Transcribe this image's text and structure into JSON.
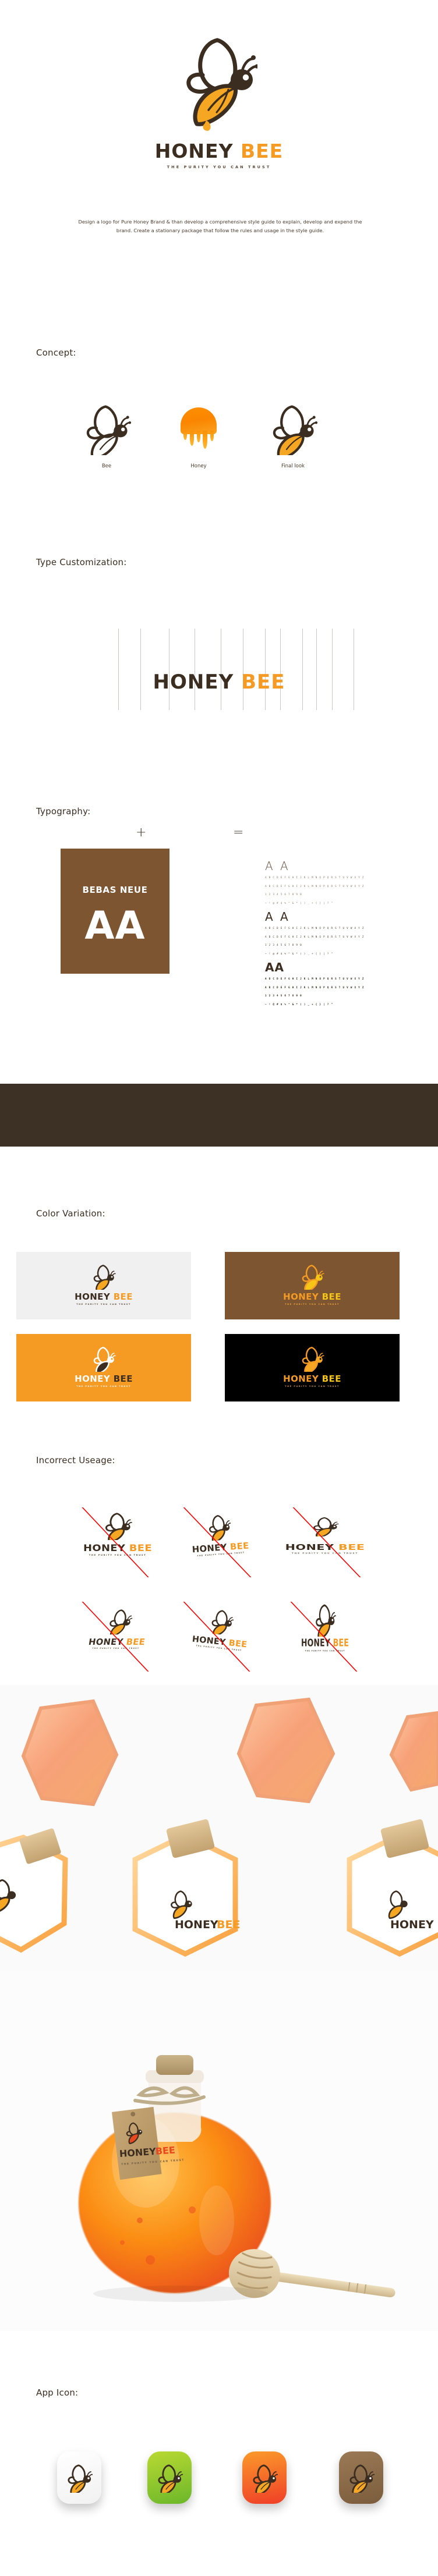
{
  "brand": {
    "name_part1": "HONEY",
    "name_part2": "BEE",
    "tagline": "THE PURITY YOU CAN TRUST",
    "description": "Design a logo for Pure Honey Brand & than develop a comprehensive style guide to explain, develop and expend the brand. Create a stationary package that follow the rules and usage in the style guide.",
    "colors": {
      "brown_dark": "#3b2d20",
      "brown_band": "#3d3025",
      "brown_card": "#7d5530",
      "orange": "#f59a23",
      "orange_deep": "#fb8500",
      "amber": "#f5c518",
      "light_grey": "#f0f0f0",
      "black": "#000000",
      "white": "#ffffff",
      "red_strike": "#ff0000",
      "green": "#8cc63e"
    }
  },
  "sections": {
    "concept": {
      "heading": "Concept:",
      "items": [
        {
          "label": "Bee",
          "icon": "bee-outline-icon"
        },
        {
          "label": "Honey",
          "icon": "honey-drip-icon"
        },
        {
          "label": "Final look",
          "icon": "bee-final-icon"
        }
      ],
      "operators": [
        "+",
        "="
      ]
    },
    "type_customization": {
      "heading": "Type Customization:",
      "word_part1": "HONEY",
      "word_part2": "BEE",
      "guide_line_count": 12
    },
    "typography": {
      "heading": "Typography:",
      "font_name": "BEBAS NEUE",
      "card_sample": "AA",
      "specimens": [
        {
          "weight": "light",
          "sample": "A A",
          "uppercase": "A B C D E F G H I J K L M N O P Q R S T U V W X Y Z",
          "lowercase": "A B C D E F G H I J K L M N O P Q R S T U V W X Y Z",
          "numerals": "1 2 3 4 5 6 7 8 9 0",
          "symbols": "~ ! @ # $ % ^ & * ( ) _ + { } | ? \""
        },
        {
          "weight": "regular",
          "sample": "A A",
          "uppercase": "A B C D E F G H I J K L M N O P Q R S T U V W X Y Z",
          "lowercase": "A B C D E F G H I J K L M N O P Q R S T U V W X Y Z",
          "numerals": "1 2 3 4 5 6 7 8 9 0",
          "symbols": "~ ! @ # $ % ^ & * ( ) _ + { } | ? \""
        },
        {
          "weight": "bold",
          "sample": "AA",
          "uppercase": "A B C D E F G H I J K L M N O P Q R S T U V W X Y Z",
          "lowercase": "A B C D E F G H I J K L M N O P Q R S T U V W X Y Z",
          "numerals": "1 2 3 4 5 6 7 8 9 0",
          "symbols": "~ ! @ # $ % ^ & * ( ) _ + { } | ? \""
        }
      ]
    },
    "color_variation": {
      "heading": "Color Variation:",
      "swatches": [
        {
          "name": "light",
          "bg": "#f0f0f0",
          "word1_color": "#3b2d20",
          "word2_color": "#f59a23",
          "tag_color": "#5a4734",
          "body_color": "#f5a623",
          "outline_color": "#3b2d20"
        },
        {
          "name": "brown",
          "bg": "#7d5530",
          "word1_color": "#f59a23",
          "word2_color": "#f5c518",
          "tag_color": "#f0a93c",
          "body_color": "#f5c518",
          "outline_color": "#f59a23"
        },
        {
          "name": "orange",
          "bg": "#f59a23",
          "word1_color": "#ffffff",
          "word2_color": "#3b2d20",
          "tag_color": "#ffffff",
          "body_color": "#3b2d20",
          "outline_color": "#ffffff"
        },
        {
          "name": "black",
          "bg": "#000000",
          "word1_color": "#f59a23",
          "word2_color": "#f5c518",
          "tag_color": "#d79a3c",
          "body_color": "#f5a623",
          "outline_color": "#f59a23"
        }
      ]
    },
    "incorrect_usage": {
      "heading": "Incorrect Useage:",
      "variants": [
        {
          "name": "stretched-horizontal"
        },
        {
          "name": "arched-warped"
        },
        {
          "name": "condensed-wide"
        },
        {
          "name": "skewed-italic"
        },
        {
          "name": "rotated"
        },
        {
          "name": "squeezed-vertical"
        }
      ]
    },
    "mockups": {
      "hex_jars": {
        "name": "hexagonal-honey-jar-mockup",
        "label_word1": "HONEY",
        "label_word2": "BEE"
      },
      "round_bottle": {
        "name": "round-honey-bottle-mockup",
        "tag_word1": "HONEY",
        "tag_word2": "BEE",
        "dipper": "wooden-honey-dipper"
      }
    },
    "app_icon": {
      "heading": "App Icon:",
      "icons": [
        {
          "name": "white",
          "bg_from": "#ffffff",
          "bg_to": "#f2f2f2"
        },
        {
          "name": "green",
          "bg_from": "#b9d932",
          "bg_to": "#6bb72a"
        },
        {
          "name": "orange",
          "bg_from": "#fb9a2a",
          "bg_to": "#ef3f28"
        },
        {
          "name": "brown",
          "bg_from": "#9a7a56",
          "bg_to": "#7b5c3c"
        }
      ]
    }
  }
}
